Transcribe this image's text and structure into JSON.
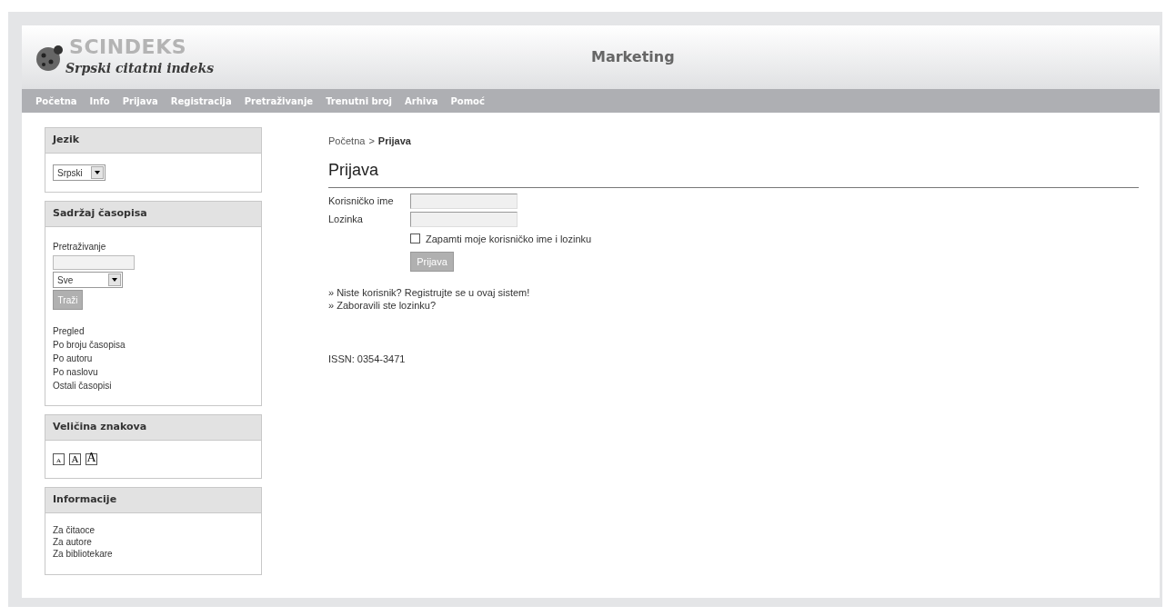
{
  "header": {
    "logo_mark": "SCINDEKS",
    "logo_text": "Srpski citatni indeks",
    "title": "Marketing"
  },
  "nav": [
    "Početna",
    "Info",
    "Prijava",
    "Registracija",
    "Pretraživanje",
    "Trenutni broj",
    "Arhiva",
    "Pomoć"
  ],
  "sidebar": {
    "language": {
      "title": "Jezik",
      "value": "Srpski"
    },
    "contents": {
      "title": "Sadržaj časopisa",
      "search_label": "Pretraživanje",
      "scope": "Sve",
      "button": "Traži",
      "browse_title": "Pregled",
      "links": [
        "Po broju časopisa",
        "Po autoru",
        "Po naslovu",
        "Ostali časopisi"
      ]
    },
    "font_size": {
      "title": "Veličina znakova",
      "sizes": [
        {
          "label": "A",
          "kind": "small"
        },
        {
          "label": "A",
          "kind": "medium"
        },
        {
          "label": "A",
          "kind": "large"
        }
      ]
    },
    "info": {
      "title": "Informacije",
      "links": [
        "Za čitaoce",
        "Za autore",
        "Za bibliotekare"
      ]
    }
  },
  "main": {
    "breadcrumb": [
      {
        "label": "Početna",
        "current": false
      },
      {
        "label": "Prijava",
        "current": true
      }
    ],
    "breadcrumb_separator": ">",
    "heading": "Prijava",
    "fields": [
      {
        "label": "Korisničko ime"
      },
      {
        "label": "Lozinka"
      }
    ],
    "remember": {
      "label": "Zapamti moje korisničko ime i lozinku",
      "checked": false
    },
    "submit": "Prijava",
    "links": [
      "» Niste korisnik? Registrujte se u ovaj sistem!",
      "» Zaboravili ste lozinku?"
    ],
    "issn": "ISSN: 0354-3471"
  }
}
